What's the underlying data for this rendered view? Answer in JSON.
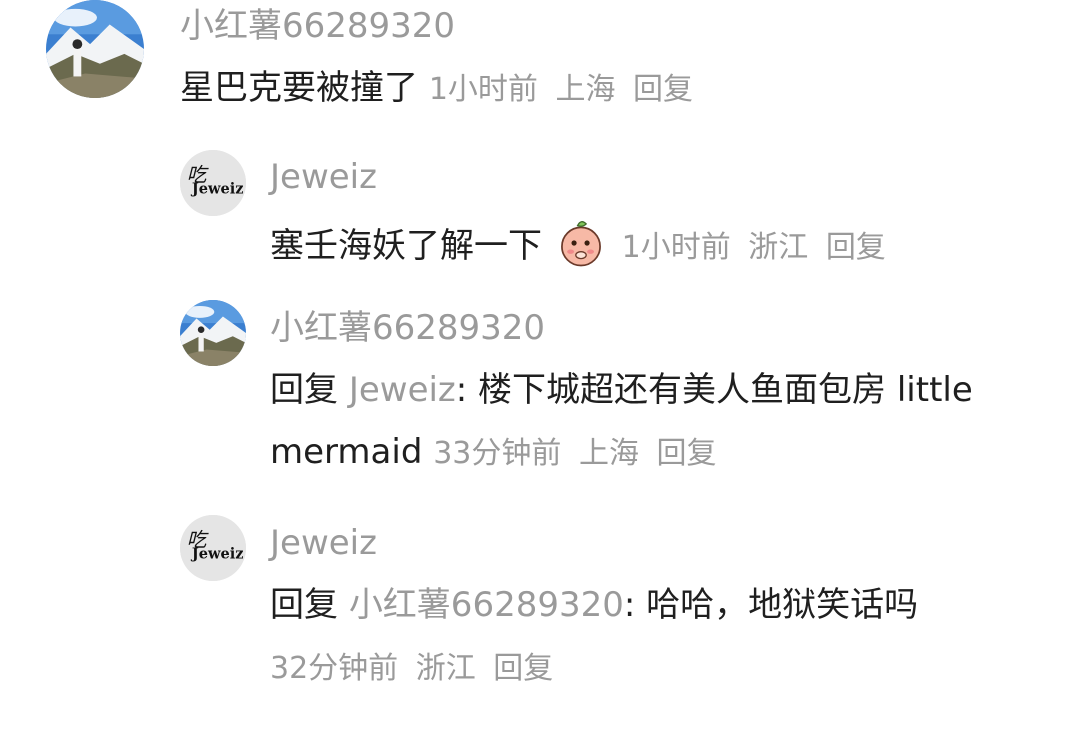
{
  "comments": [
    {
      "author": "小红薯66289320",
      "text": "星巴克要被撞了",
      "time": "1小时前",
      "location": "上海",
      "reply_label": "回复"
    },
    {
      "author": "Jeweiz",
      "text": "塞壬海妖了解一下",
      "emoji": "peach-cover-mouth-emoji",
      "time": "1小时前",
      "location": "浙江",
      "reply_label": "回复"
    },
    {
      "author": "小红薯66289320",
      "reply_prefix": "回复",
      "mention": "Jeweiz",
      "text_line1": ": 楼下城超还有美人鱼面包房 little",
      "text_line2": "mermaid",
      "time": "33分钟前",
      "location": "上海",
      "reply_label": "回复"
    },
    {
      "author": "Jeweiz",
      "reply_prefix": "回复",
      "mention": "小红薯66289320",
      "text": ": 哈哈，地狱笑话吗",
      "time": "32分钟前",
      "location": "浙江",
      "reply_label": "回复"
    }
  ]
}
